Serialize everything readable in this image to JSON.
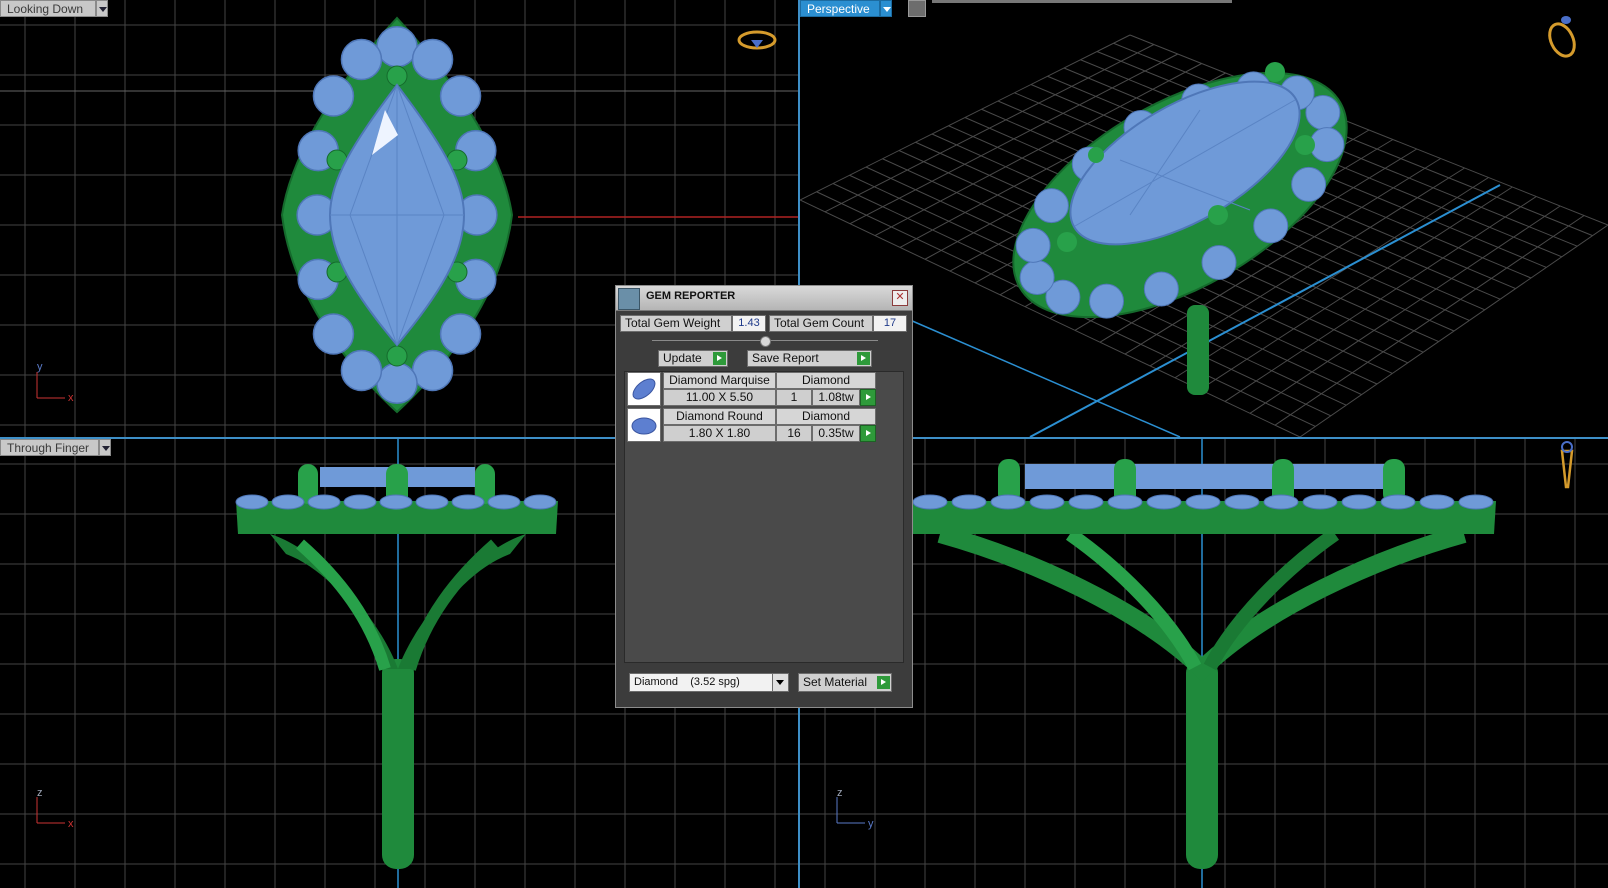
{
  "viewports": {
    "top_left": {
      "label": "Looking Down",
      "axis_a": "y",
      "axis_b": "x"
    },
    "top_right": {
      "label": "Perspective"
    },
    "bottom_left": {
      "label": "Through Finger",
      "axis_a": "z",
      "axis_b": "x"
    },
    "bottom_right": {
      "axis_a": "z",
      "axis_b": "y"
    }
  },
  "gem_reporter": {
    "title": "GEM REPORTER",
    "close": "✕",
    "total_weight_label": "Total Gem Weight",
    "total_weight_value": "1.43",
    "total_count_label": "Total Gem Count",
    "total_count_value": "17",
    "update_label": "Update",
    "save_report_label": "Save Report",
    "rows": [
      {
        "name": "Diamond Marquise",
        "material": "Diamond",
        "size": "11.00 X 5.50",
        "qty": "1",
        "weight": "1.08tw"
      },
      {
        "name": "Diamond Round",
        "material": "Diamond",
        "size": "1.80 X 1.80",
        "qty": "16",
        "weight": "0.35tw"
      }
    ],
    "material_select": "Diamond    (3.52 spg)",
    "set_material_label": "Set Material"
  },
  "colors": {
    "metal": "#1f8a3c",
    "gem": "#6f9ad8",
    "grid": "#4a4a4a",
    "accent": "#2b8fd1"
  }
}
